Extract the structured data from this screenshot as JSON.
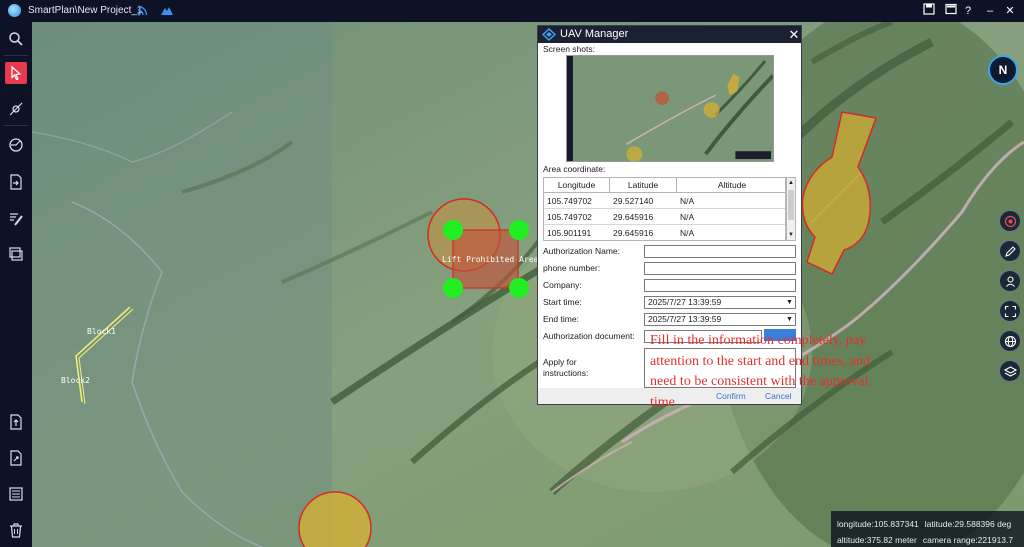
{
  "app": {
    "title": "SmartPlan\\New Project_1"
  },
  "titlebar": {
    "icons": [
      "rss-icon",
      "mountain-icon",
      "save-icon",
      "screen-icon",
      "help-icon",
      "minimize-icon",
      "close-icon"
    ],
    "help_glyph": "?",
    "minimize_glyph": "–",
    "close_glyph": "✕"
  },
  "toolbar": {
    "tools": [
      "search-icon",
      "select-pointer-icon",
      "waypoint-icon",
      "measure-icon",
      "import-icon",
      "edit-route-icon",
      "layers-window-icon",
      "export-icon",
      "share-icon",
      "list-icon",
      "trash-icon"
    ],
    "accent": "#e83a4f"
  },
  "map": {
    "no_fly_label": "Lift Prohibited Area1",
    "block1": "Block1",
    "block2": "Block2",
    "compass": "N"
  },
  "right_tools": [
    "radar-icon",
    "pencil-icon",
    "person-pin-icon",
    "fullscreen-icon",
    "globe-icon",
    "layers-icon"
  ],
  "status": {
    "longitude": "longitude:105.837341",
    "latitude": "latitude:29.588396 deg",
    "altitude": "altitude:375.82 meter",
    "camera_range": "camera range:221913.7"
  },
  "dialog": {
    "title": "UAV Manager",
    "close": "✕",
    "screen_shots_label": "Screen shots:",
    "area_label": "Area coordinate:",
    "columns": [
      "Longitude",
      "Latitude",
      "Altitude"
    ],
    "rows": [
      [
        "105.749702",
        "29.527140",
        "N/A"
      ],
      [
        "105.749702",
        "29.645916",
        "N/A"
      ],
      [
        "105.901191",
        "29.645916",
        "N/A"
      ]
    ],
    "authorization_name_label": "Authorization Name:",
    "phone_label": "phone number:",
    "company_label": "Company:",
    "start_label": "Start time:",
    "start_value": "2025/7/27 13:39:59",
    "end_label": "End time:",
    "end_value": "2025/7/27 13:39:59",
    "document_label": "Authorization document:",
    "instructions_label_1": "Apply for",
    "instructions_label_2": "instructions:",
    "confirm": "Confirm",
    "cancel": "Cancel",
    "dropdown_glyph": "▼",
    "scroll_up": "▲",
    "scroll_down": "▼"
  },
  "annotation": "Fill in the information completely, pay attention to the start and end times, and need to be consistent with the approval time",
  "colors": {
    "no_fly_fill": "#d8b030",
    "no_fly_stroke": "#d42a2a",
    "vertex": "#22ee22",
    "route": "#f5f07a",
    "dialog_header": "#1b2033",
    "annotation": "#e53030"
  }
}
